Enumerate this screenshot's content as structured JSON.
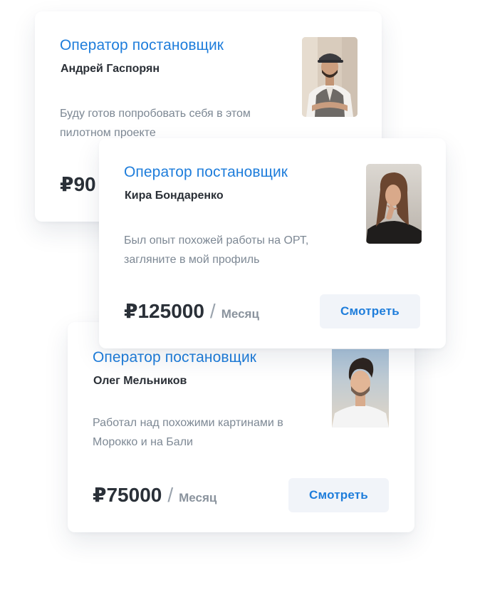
{
  "cards": [
    {
      "title": "Оператор постановщик",
      "name": "Андрей Гаспорян",
      "description": "Буду готов попробовать себя в этом пилотном проекте",
      "price": "₽90",
      "period": "",
      "button_label": "",
      "avatar_icon": "avatar-man-cap-vest"
    },
    {
      "title": "Оператор постановщик",
      "name": "Кира Бондаренко",
      "description": "Был опыт похожей работы на ОРТ, загляните в мой профиль",
      "price": "₽125000",
      "slash": "/",
      "period": "Месяц",
      "button_label": "Смотреть",
      "avatar_icon": "avatar-woman-long-hair"
    },
    {
      "title": "Оператор постановщик",
      "name": "Олег Мельников",
      "description": "Работал над похожими картинами в Морокко и на Бали",
      "price": "₽75000",
      "slash": "/",
      "period": "Месяц",
      "button_label": "Смотреть",
      "avatar_icon": "avatar-man-styled-hair"
    }
  ],
  "colors": {
    "accent": "#1e7ddb",
    "name_text": "#2a2f36",
    "description_text": "#7d8894",
    "button_bg": "#f1f4f9"
  }
}
